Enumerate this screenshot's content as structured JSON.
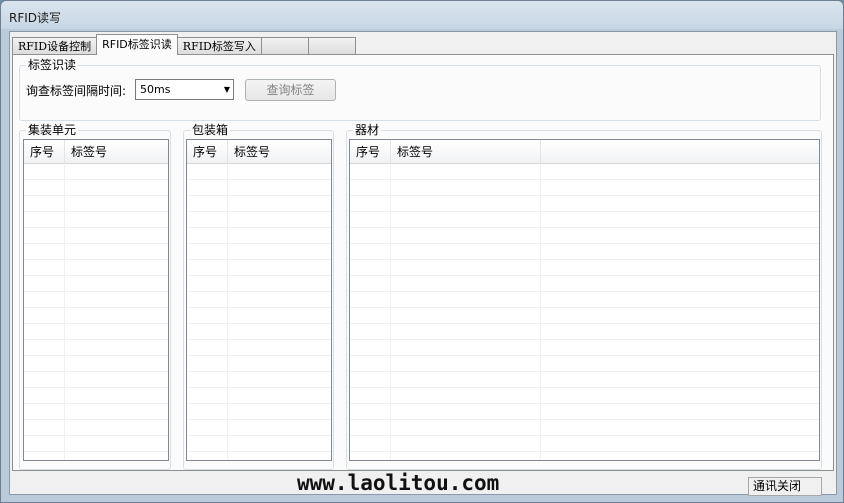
{
  "window": {
    "title": "RFID读写"
  },
  "tabs": [
    {
      "label": "RFID设备控制"
    },
    {
      "label": "RFID标签识读"
    },
    {
      "label": "RFID标签写入"
    },
    {
      "label": ""
    },
    {
      "label": ""
    }
  ],
  "read_group": {
    "legend": "标签识读",
    "interval_label": "询查标签间隔时间:",
    "interval_value": "50ms",
    "query_button": "查询标签"
  },
  "lists": [
    {
      "legend": "集装单元",
      "columns": [
        "序号",
        "标签号"
      ]
    },
    {
      "legend": "包装箱",
      "columns": [
        "序号",
        "标签号"
      ]
    },
    {
      "legend": "器材",
      "columns": [
        "序号",
        "标签号",
        ""
      ]
    }
  ],
  "watermark": "www.laolitou.com",
  "status": {
    "connection": "通讯关闭"
  }
}
